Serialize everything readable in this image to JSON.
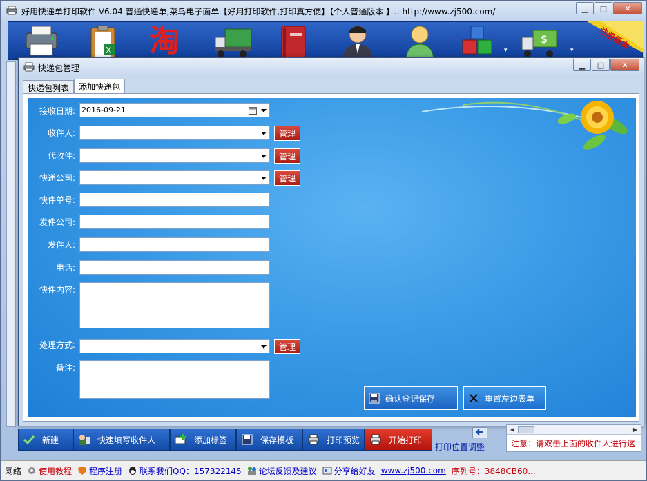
{
  "app": {
    "title": "好用快递单打印软件 V6.04 普通快递单,菜鸟电子面单【好用打印软件,打印真方便】【个人普通版本 】..  http://www.zj500.com/",
    "min_glyph": "▁",
    "max_glyph": "□",
    "close_glyph": "✕"
  },
  "toolbar": {
    "icons": [
      "printer-icon",
      "clipboard-excel-icon",
      "taobao-icon",
      "truck-icon",
      "address-book-icon",
      "user-admin-icon",
      "user-icon",
      "cubes-icon",
      "money-truck-icon"
    ],
    "taobao_char": "淘",
    "dropdown_glyph": "▾",
    "register_ribbon": "注册版本"
  },
  "dialog": {
    "title": "快递包管理",
    "tabs": [
      "快递包列表",
      "添加快递包"
    ],
    "active_tab": "添加快递包"
  },
  "form": {
    "date_label": "接收日期:",
    "date_value": "2016-09-21",
    "recipient_label": "收件人:",
    "proxy_label": "代收件:",
    "courier_label": "快递公司:",
    "waybill_label": "快件单号:",
    "sender_company_label": "发件公司:",
    "sender_label": "发件人:",
    "phone_label": "电话:",
    "content_label": "快件内容:",
    "handling_label": "处理方式:",
    "remark_label": "备注:",
    "manage_label": "管理",
    "save_button": "确认登记保存",
    "reset_button": "重置左边表单"
  },
  "actions": {
    "new": "新建",
    "quick_fill": "快速填写收件人",
    "add_label": "添加标签",
    "save_template": "保存模板",
    "print_preview": "打印预览",
    "start_print": "开始打印",
    "position_adjust": "打印位置调整",
    "note": "注意：请双击上面的收件人进行这"
  },
  "statusbar": {
    "network": "网络",
    "tutorial": "使用教程",
    "register": "程序注册",
    "contact": "联系我们QQ：157322145",
    "forum": "论坛反馈及建议",
    "share": "分享给好友",
    "site": "www.zj500.com",
    "serial": "序列号：3848CB60..."
  },
  "colors": {
    "form_bg": "#3a9ae6",
    "manage_red": "#c1271c",
    "toolbar_blue": "#1e50b0"
  }
}
